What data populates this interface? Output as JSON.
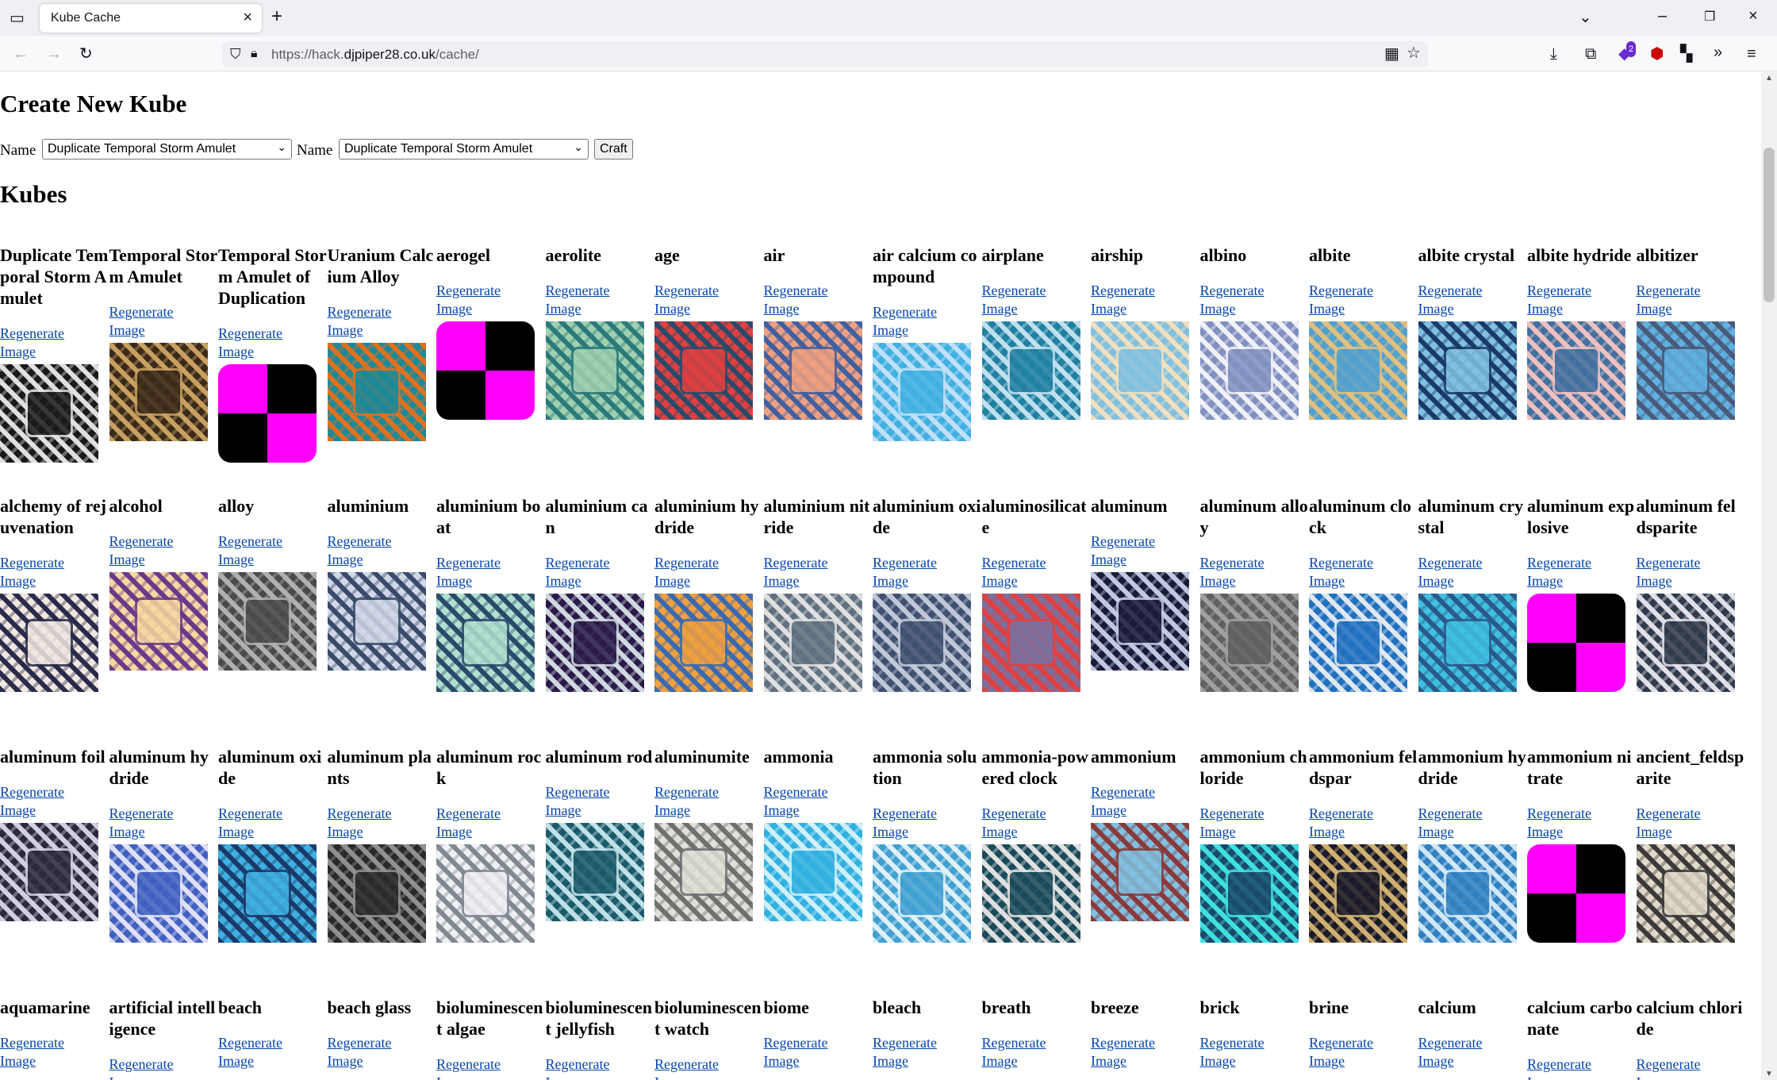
{
  "browser": {
    "tab_title": "Kube Cache",
    "url_prefix": "https://hack.",
    "url_domain": "djpiper28.co.uk",
    "url_path": "/cache/",
    "extension_badge": "2"
  },
  "create": {
    "heading": "Create New Kube",
    "label1": "Name",
    "select1_value": "Duplicate Temporal Storm Amulet",
    "label2": "Name",
    "select2_value": "Duplicate Temporal Storm Amulet",
    "craft_label": "Craft"
  },
  "kubes_heading": "Kubes",
  "regen_line1": "Regenerate",
  "regen_line2": "Image",
  "colors": {
    "link": "#0645ad",
    "missing_magenta": "#ff00ff",
    "missing_black": "#000000"
  },
  "kubes": [
    {
      "name": "Duplicate Temporal Storm Amulet",
      "bg": "#1a1a1a",
      "fg": "#e0e0e0"
    },
    {
      "name": "Temporal Storm Amulet",
      "bg": "#3a2a1a",
      "fg": "#c8a060"
    },
    {
      "name": "Temporal Storm Amulet of Duplication",
      "missing": true
    },
    {
      "name": "Uranium Calcium Alloy",
      "bg": "#1a8a9a",
      "fg": "#e07020"
    },
    {
      "name": "aerogel",
      "missing": true
    },
    {
      "name": "aerolite",
      "bg": "#a0d0b0",
      "fg": "#2a7a7a"
    },
    {
      "name": "age",
      "bg": "#e04040",
      "fg": "#2a4a6a"
    },
    {
      "name": "air",
      "bg": "#f0a080",
      "fg": "#4060a0"
    },
    {
      "name": "air calcium compound",
      "bg": "#40b0e0",
      "fg": "#c0e0f8"
    },
    {
      "name": "airplane",
      "bg": "#2080a0",
      "fg": "#c0e0f0"
    },
    {
      "name": "airship",
      "bg": "#80c0e0",
      "fg": "#f0e0c0"
    },
    {
      "name": "albino",
      "bg": "#8090c0",
      "fg": "#f0f0f8"
    },
    {
      "name": "albite",
      "bg": "#50a0d0",
      "fg": "#e0c080"
    },
    {
      "name": "albite crystal",
      "bg": "#80c0e0",
      "fg": "#1a3a6a"
    },
    {
      "name": "albite hydride",
      "bg": "#4070a0",
      "fg": "#f0c0c0"
    },
    {
      "name": "albitizer",
      "bg": "#60b0e0",
      "fg": "#4a5a7a"
    },
    {
      "name": "alchemy of rejuvenation",
      "bg": "#f0e8e0",
      "fg": "#2a2a4a"
    },
    {
      "name": "alcohol",
      "bg": "#f8d8a0",
      "fg": "#6a3a8a"
    },
    {
      "name": "alloy",
      "bg": "#4a4a4a",
      "fg": "#b0b0b0"
    },
    {
      "name": "aluminium",
      "bg": "#d0d8e8",
      "fg": "#3a4a6a"
    },
    {
      "name": "aluminium boat",
      "bg": "#b0e0d0",
      "fg": "#2a4a6a"
    },
    {
      "name": "aluminium can",
      "bg": "#2a1a4a",
      "fg": "#d0d8e0"
    },
    {
      "name": "aluminium hydride",
      "bg": "#f0a040",
      "fg": "#3a6ab0"
    },
    {
      "name": "aluminium nitride",
      "bg": "#607080",
      "fg": "#e0e0e0"
    },
    {
      "name": "aluminium oxide",
      "bg": "#405070",
      "fg": "#c0c8d8"
    },
    {
      "name": "aluminosilicate",
      "bg": "#7a70a0",
      "fg": "#e04040"
    },
    {
      "name": "aluminum",
      "bg": "#1a1a3a",
      "fg": "#c0c8e0"
    },
    {
      "name": "aluminum alloy",
      "bg": "#606060",
      "fg": "#a0a0a0"
    },
    {
      "name": "aluminum clock",
      "bg": "#2070c0",
      "fg": "#e0e8f0"
    },
    {
      "name": "aluminum crystal",
      "bg": "#40c0e0",
      "fg": "#2a5a8a"
    },
    {
      "name": "aluminum explosive",
      "missing": true
    },
    {
      "name": "aluminum feldsparite",
      "bg": "#303a4a",
      "fg": "#e0e0e8"
    },
    {
      "name": "aluminum foil",
      "bg": "#2a2a3a",
      "fg": "#d0d0e0"
    },
    {
      "name": "aluminum hydride",
      "bg": "#4060c0",
      "fg": "#e0e0f8"
    },
    {
      "name": "aluminum oxide",
      "bg": "#40b0e0",
      "fg": "#1a3a6a"
    },
    {
      "name": "aluminum plants",
      "bg": "#2a2a2a",
      "fg": "#909090"
    },
    {
      "name": "aluminum rock",
      "bg": "#f0f0f4",
      "fg": "#808890"
    },
    {
      "name": "aluminum rod",
      "bg": "#1a5a6a",
      "fg": "#c0e0e8"
    },
    {
      "name": "aluminumite",
      "bg": "#e0e0d8",
      "fg": "#707070"
    },
    {
      "name": "ammonia",
      "bg": "#30b0e0",
      "fg": "#d0f0f8"
    },
    {
      "name": "ammonia solution",
      "bg": "#40a0d0",
      "fg": "#e0f0f8"
    },
    {
      "name": "ammonia-powered clock",
      "bg": "#1a4a5a",
      "fg": "#e0e0e0"
    },
    {
      "name": "ammonium",
      "bg": "#80c0e0",
      "fg": "#8a3a3a"
    },
    {
      "name": "ammonium chloride",
      "bg": "#1a4a6a",
      "fg": "#40e0e0"
    },
    {
      "name": "ammonium feldspar",
      "bg": "#1a1a2a",
      "fg": "#d0b070"
    },
    {
      "name": "ammonium hydride",
      "bg": "#3080c0",
      "fg": "#d0e8f8"
    },
    {
      "name": "ammonium nitrate",
      "missing": true
    },
    {
      "name": "ancient_feldsparite",
      "bg": "#e0d8c8",
      "fg": "#3a3a3a"
    },
    {
      "name": "aquamarine"
    },
    {
      "name": "artificial intelligence"
    },
    {
      "name": "beach"
    },
    {
      "name": "beach glass"
    },
    {
      "name": "bioluminescent algae"
    },
    {
      "name": "bioluminescent jellyfish"
    },
    {
      "name": "bioluminescent watch"
    },
    {
      "name": "biome"
    },
    {
      "name": "bleach"
    },
    {
      "name": "breath"
    },
    {
      "name": "breeze"
    },
    {
      "name": "brick"
    },
    {
      "name": "brine"
    },
    {
      "name": "calcium"
    },
    {
      "name": "calcium carbonate"
    },
    {
      "name": "calcium chloride"
    }
  ]
}
